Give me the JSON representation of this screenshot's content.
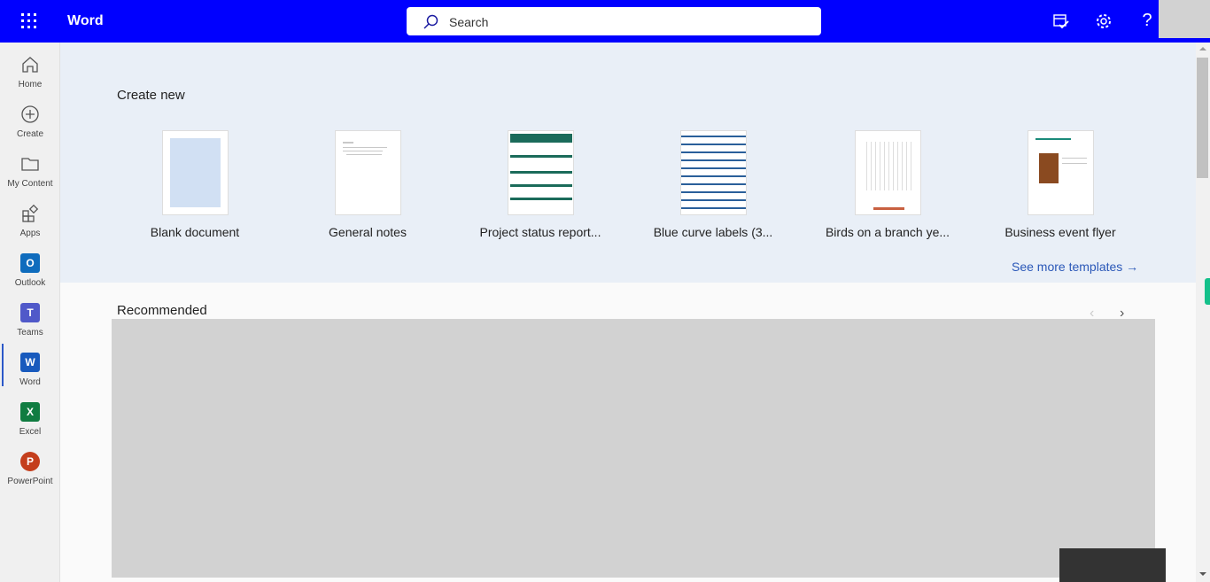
{
  "header": {
    "app_name": "Word",
    "search_placeholder": "Search",
    "icons": [
      "waffle-icon",
      "search-icon",
      "calendar-check-icon",
      "gear-icon",
      "help-icon"
    ]
  },
  "sidebar": {
    "items": [
      {
        "label": "Home",
        "icon": "home-icon"
      },
      {
        "label": "Create",
        "icon": "plus-circle-icon"
      },
      {
        "label": "My Content",
        "icon": "folder-icon"
      },
      {
        "label": "Apps",
        "icon": "apps-icon"
      },
      {
        "label": "Outlook",
        "icon": "outlook-icon",
        "color": "#0f6cbd",
        "letter": "O"
      },
      {
        "label": "Teams",
        "icon": "teams-icon",
        "color": "#5059c9",
        "letter": "T"
      },
      {
        "label": "Word",
        "icon": "word-icon",
        "color": "#185abd",
        "letter": "W",
        "active": true
      },
      {
        "label": "Excel",
        "icon": "excel-icon",
        "color": "#107c41",
        "letter": "X"
      },
      {
        "label": "PowerPoint",
        "icon": "powerpoint-icon",
        "color": "#c43e1c",
        "letter": "P"
      }
    ]
  },
  "create_new": {
    "title": "Create new",
    "templates": [
      {
        "label": "Blank document"
      },
      {
        "label": "General notes"
      },
      {
        "label": "Project status report..."
      },
      {
        "label": "Blue curve labels (3..."
      },
      {
        "label": "Birds on a branch ye..."
      },
      {
        "label": "Business event flyer"
      }
    ],
    "see_more": "See more templates →"
  },
  "recommended": {
    "title": "Recommended"
  },
  "colors": {
    "header": "#0000ff",
    "hero": "#e9eff7",
    "accent": "#2b58b8"
  }
}
